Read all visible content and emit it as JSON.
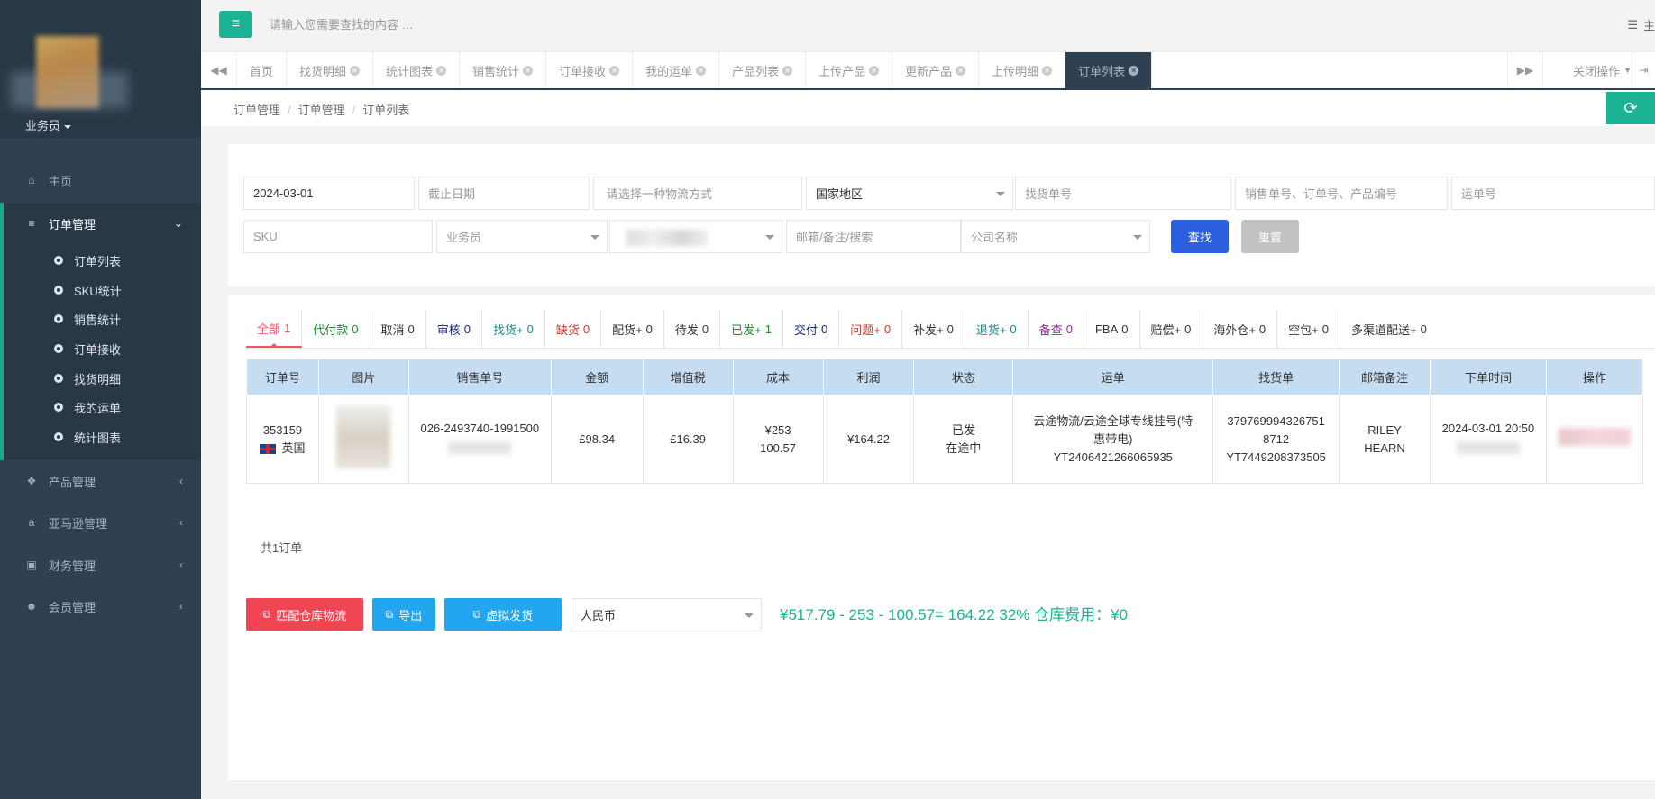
{
  "sidebar": {
    "role": "业务员",
    "items": [
      {
        "label": "主页",
        "icon": "home-icon"
      },
      {
        "label": "订单管理",
        "icon": "list-icon"
      },
      {
        "label": "产品管理",
        "icon": "cubes-icon"
      },
      {
        "label": "亚马逊管理",
        "icon": "amazon-icon"
      },
      {
        "label": "财务管理",
        "icon": "money-icon"
      },
      {
        "label": "会员管理",
        "icon": "users-icon"
      }
    ],
    "sub_items": [
      "订单列表",
      "SKU统计",
      "销售统计",
      "订单接收",
      "找货明细",
      "我的运单",
      "统计图表"
    ]
  },
  "topbar": {
    "search_placeholder": "请输入您需要查找的内容 …",
    "right_label": "主"
  },
  "tabs": {
    "items": [
      "首页",
      "找货明细",
      "统计图表",
      "销售统计",
      "订单接收",
      "我的运单",
      "产品列表",
      "上传产品",
      "更新产品",
      "上传明细",
      "订单列表"
    ],
    "close_ops": "关闭操作"
  },
  "breadcrumb": [
    "订单管理",
    "订单管理",
    "订单列表"
  ],
  "filters": {
    "start_date": "2024-03-01",
    "end_date_placeholder": "截止日期",
    "logistics_placeholder": "请选择一种物流方式",
    "country": "国家地区",
    "find_no_placeholder": "找货单号",
    "sales_no_placeholder": "销售单号、订单号、产品编号",
    "waybill_placeholder": "运单号",
    "sku_placeholder": "SKU",
    "salesman": "业务员",
    "email_placeholder": "邮箱/备注/搜索",
    "company": "公司名称",
    "search_label": "查找",
    "reset_label": "重置"
  },
  "status_tabs": [
    {
      "label": "全部",
      "count": "1",
      "color": "#ed5565"
    },
    {
      "label": "代付款",
      "count": "0",
      "color": "#1a8c2a"
    },
    {
      "label": "取消",
      "count": "0",
      "color": "#333333"
    },
    {
      "label": "审核",
      "count": "0",
      "color": "#1a237e"
    },
    {
      "label": "找货+",
      "count": "0",
      "color": "#1b8a8a"
    },
    {
      "label": "缺货",
      "count": "0",
      "color": "#c0392b"
    },
    {
      "label": "配货+",
      "count": "0",
      "color": "#333333"
    },
    {
      "label": "待发",
      "count": "0",
      "color": "#333333"
    },
    {
      "label": "已发+",
      "count": "1",
      "color": "#1a8c2a"
    },
    {
      "label": "交付",
      "count": "0",
      "color": "#1a237e"
    },
    {
      "label": "问题+",
      "count": "0",
      "color": "#c0392b"
    },
    {
      "label": "补发+",
      "count": "0",
      "color": "#333333"
    },
    {
      "label": "退货+",
      "count": "0",
      "color": "#1b8a8a"
    },
    {
      "label": "备查",
      "count": "0",
      "color": "#8e24aa"
    },
    {
      "label": "FBA",
      "count": "0",
      "color": "#333333"
    },
    {
      "label": "赔偿+",
      "count": "0",
      "color": "#333333"
    },
    {
      "label": "海外仓+",
      "count": "0",
      "color": "#333333"
    },
    {
      "label": "空包+",
      "count": "0",
      "color": "#333333"
    },
    {
      "label": "多渠道配送+",
      "count": "0",
      "color": "#333333"
    }
  ],
  "table": {
    "headers": [
      "订单号",
      "图片",
      "销售单号",
      "金额",
      "增值税",
      "成本",
      "利润",
      "状态",
      "运单",
      "找货单",
      "邮箱备注",
      "下单时间",
      "操作"
    ],
    "rows": [
      {
        "order_no": "353159",
        "country": "英国",
        "sales_no": "026-2493740-1991500",
        "amount": "£98.34",
        "vat": "£16.39",
        "cost": "¥253 100.57",
        "profit": "¥164.22",
        "status_1": "已发",
        "status_2": "在途中",
        "waybill_1": "云途物流/云途全球专线挂号(特惠带电)",
        "waybill_2": "YT2406421266065935",
        "find_1": "3797699943267518712",
        "find_2": "YT7449208373505",
        "email_note": "RILEY HEARN",
        "order_time": "2024-03-01 20:50"
      }
    ]
  },
  "order_count": "共1订单",
  "bottom": {
    "match_label": "匹配仓库物流",
    "export_label": "导出",
    "virtual_label": "虚拟发货",
    "currency": "人民币",
    "summary": "¥517.79 - 253 - 100.57= 164.22 32% 仓库费用：¥0"
  }
}
